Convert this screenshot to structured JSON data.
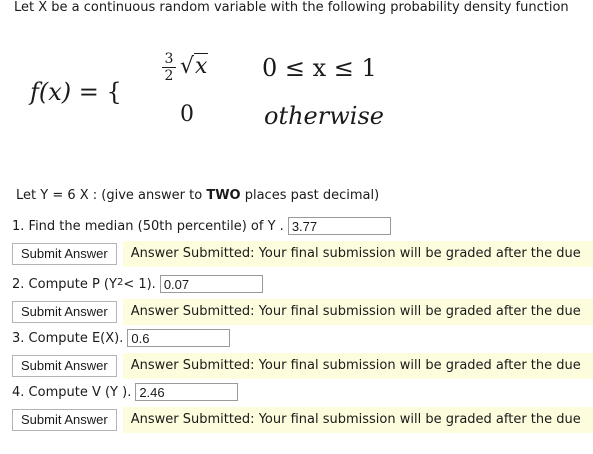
{
  "intro": "Let X be a continuous random variable with the following probability density function",
  "formula": {
    "lhs": "f(x)",
    "equals": "=",
    "brace": "{",
    "frac_num": "3",
    "frac_den": "2",
    "radical_sign": "√",
    "radicand": "x",
    "condition1": "0 ≤ x ≤ 1",
    "zero": "0",
    "condition2": "otherwise"
  },
  "instruction": {
    "text": "Let Y = 6 X :  (give answer to ",
    "bold": "TWO",
    "suffix": " places past decimal)"
  },
  "questions": [
    {
      "prefix": "1. Find the median (50th percentile) of Y .",
      "sup": "",
      "suffix": "",
      "answer": "3.77"
    },
    {
      "prefix": "2. Compute P (Y",
      "sup": "2",
      "suffix": " < 1).",
      "answer": "0.07"
    },
    {
      "prefix": "3. Compute E(X).",
      "sup": "",
      "suffix": "",
      "answer": "0.6"
    },
    {
      "prefix": "4. Compute V (Y ).",
      "sup": "",
      "suffix": "",
      "answer": "2.46"
    }
  ],
  "submit_label": "Submit Answer",
  "submitted_message": "Answer Submitted: Your final submission will be graded after the due"
}
